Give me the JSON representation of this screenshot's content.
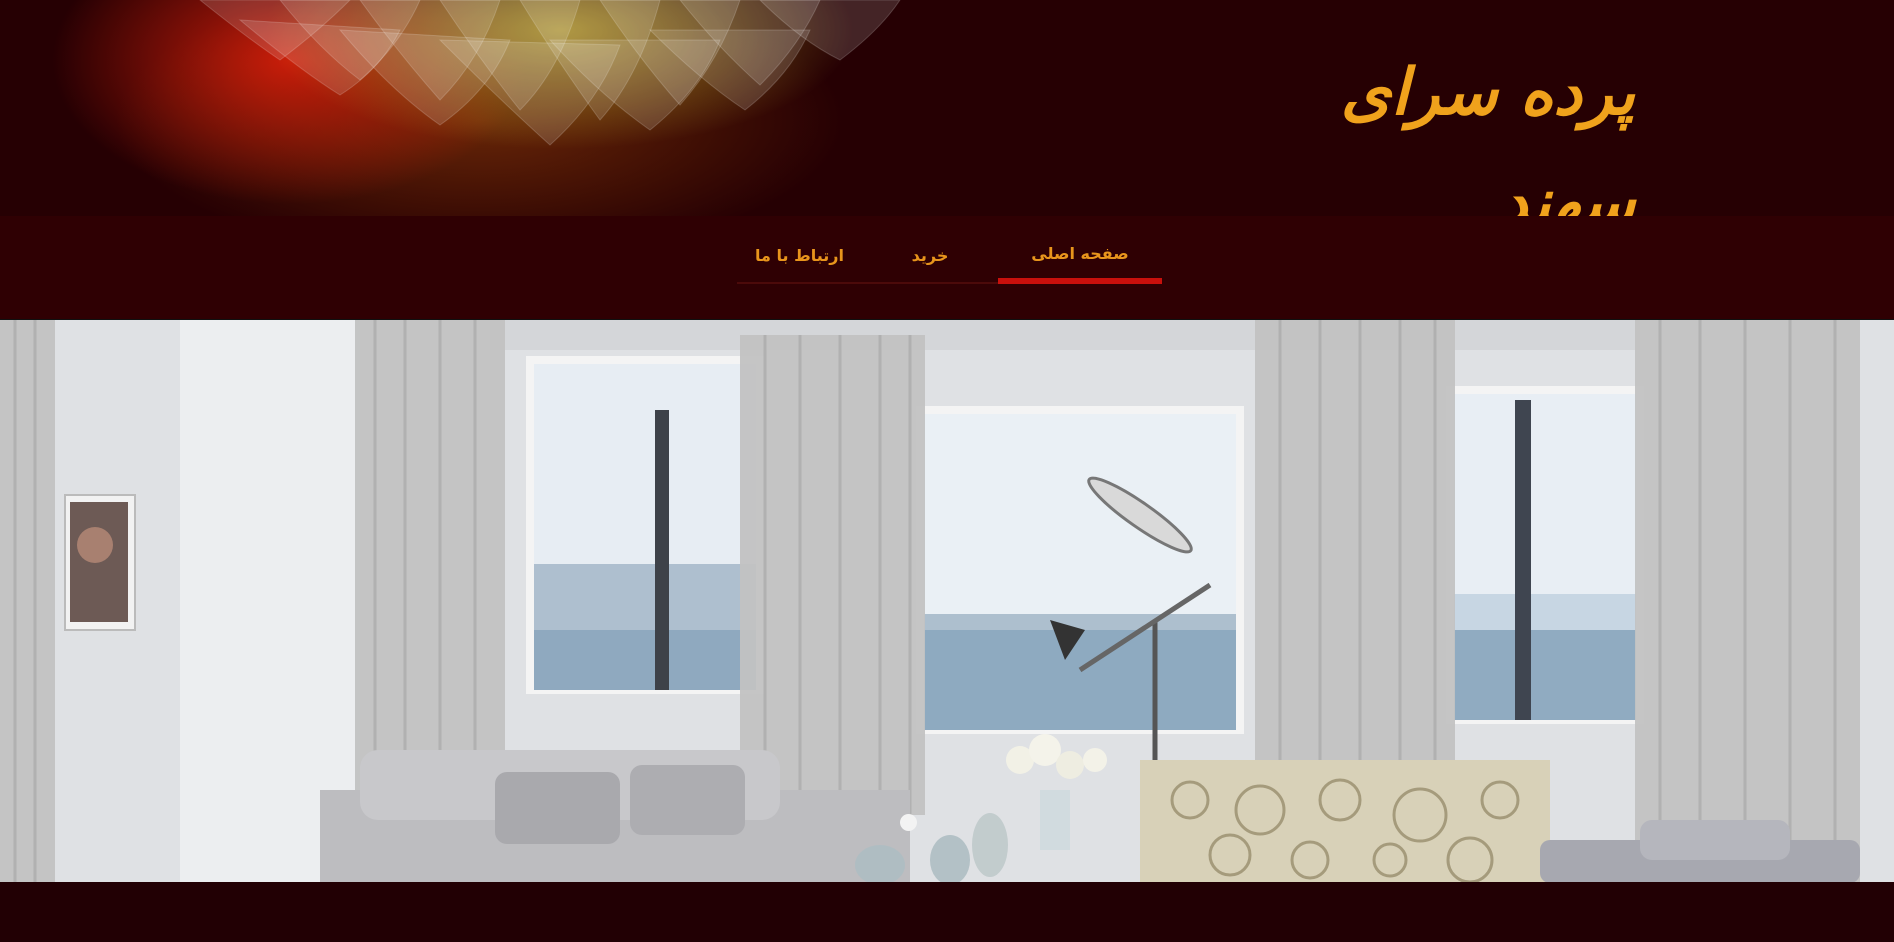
{
  "header": {
    "logo_text": "پرده سرای سهند",
    "colors": {
      "background": "#260003",
      "logo": "#f0a21c"
    }
  },
  "nav": {
    "items": [
      {
        "label": "ارتباط با ما",
        "active": false
      },
      {
        "label": "خرید",
        "active": false
      },
      {
        "label": "صفحه اصلی",
        "active": true
      }
    ],
    "colors": {
      "text": "#e8951c",
      "active_underline": "#c8100c",
      "bar": "#2f0003"
    }
  },
  "hero": {
    "image": "living-room-with-sheer-curtains-and-ocean-view",
    "slider": {
      "dots": 1,
      "active_index": 0
    }
  }
}
